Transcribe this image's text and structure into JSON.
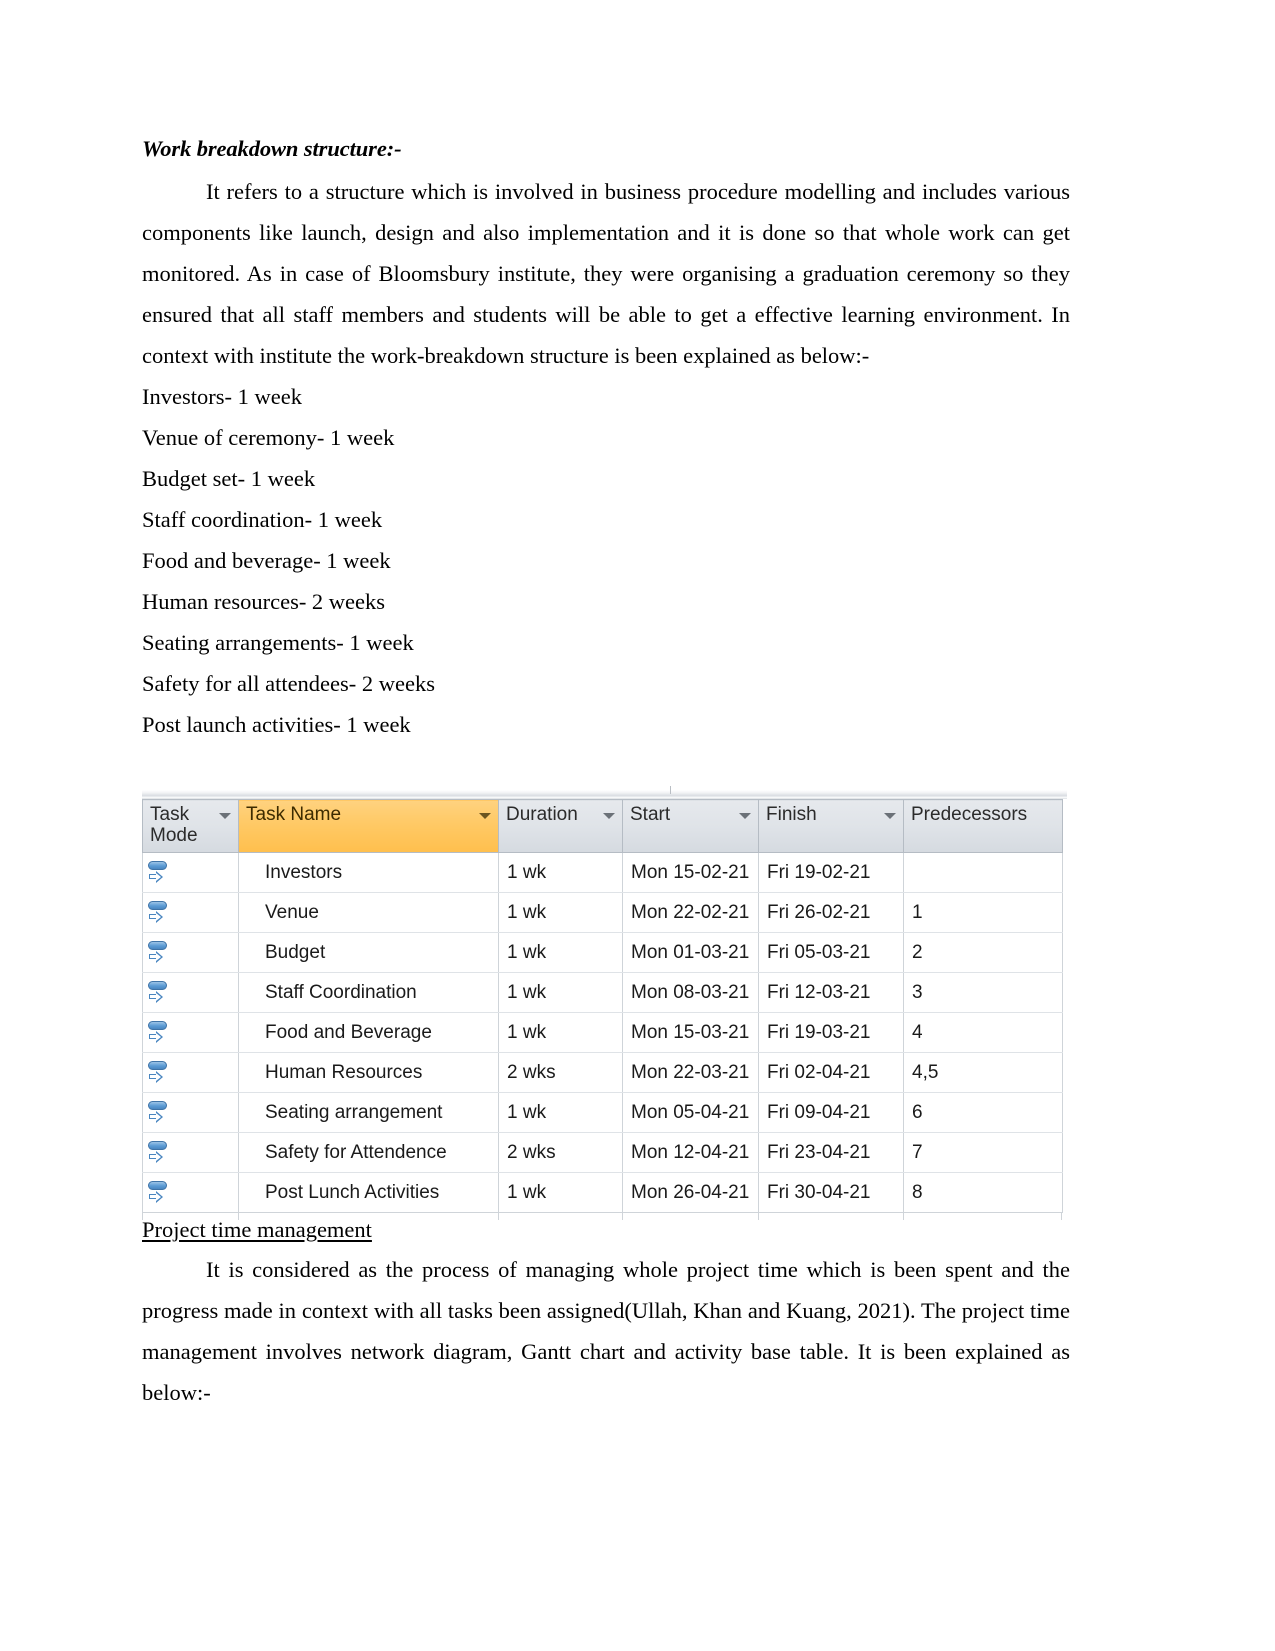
{
  "document": {
    "section1": {
      "heading": "Work breakdown structure:-",
      "paragraph": "It refers to a structure which is involved in business procedure modelling and includes various components like launch, design and also implementation and it is done so that whole work can get monitored. As in case of Bloomsbury institute, they were organising a graduation ceremony so they ensured that all staff members and students will be able to get a effective learning environment. In context with institute the work-breakdown structure is been explained as below:-",
      "wbs_items": [
        "Investors- 1 week",
        "Venue of ceremony- 1 week",
        "Budget set- 1 week",
        "Staff coordination- 1 week",
        "Food and beverage- 1 week",
        "Human resources- 2 weeks",
        "Seating arrangements- 1 week",
        "Safety for all attendees- 2 weeks",
        "Post launch activities- 1 week"
      ]
    },
    "project_table": {
      "columns": [
        {
          "label": "Task Mode",
          "selected": false
        },
        {
          "label": "Task Name",
          "selected": true
        },
        {
          "label": "Duration",
          "selected": false
        },
        {
          "label": "Start",
          "selected": false
        },
        {
          "label": "Finish",
          "selected": false
        },
        {
          "label": "Predecessors",
          "selected": false
        }
      ],
      "rows": [
        {
          "mode": "auto-scheduled-icon",
          "name": "Investors",
          "duration": "1 wk",
          "start": "Mon 15-02-21",
          "finish": "Fri 19-02-21",
          "predecessors": ""
        },
        {
          "mode": "auto-scheduled-icon",
          "name": "Venue",
          "duration": "1 wk",
          "start": "Mon 22-02-21",
          "finish": "Fri 26-02-21",
          "predecessors": "1"
        },
        {
          "mode": "auto-scheduled-icon",
          "name": "Budget",
          "duration": "1 wk",
          "start": "Mon 01-03-21",
          "finish": "Fri 05-03-21",
          "predecessors": "2"
        },
        {
          "mode": "auto-scheduled-icon",
          "name": "Staff Coordination",
          "duration": "1 wk",
          "start": "Mon 08-03-21",
          "finish": "Fri 12-03-21",
          "predecessors": "3"
        },
        {
          "mode": "auto-scheduled-icon",
          "name": "Food and Beverage",
          "duration": "1 wk",
          "start": "Mon 15-03-21",
          "finish": "Fri 19-03-21",
          "predecessors": "4"
        },
        {
          "mode": "auto-scheduled-icon",
          "name": "Human Resources",
          "duration": "2 wks",
          "start": "Mon 22-03-21",
          "finish": "Fri 02-04-21",
          "predecessors": "4,5"
        },
        {
          "mode": "auto-scheduled-icon",
          "name": "Seating arrangement",
          "duration": "1 wk",
          "start": "Mon 05-04-21",
          "finish": "Fri 09-04-21",
          "predecessors": "6"
        },
        {
          "mode": "auto-scheduled-icon",
          "name": "Safety for Attendence",
          "duration": "2 wks",
          "start": "Mon 12-04-21",
          "finish": "Fri 23-04-21",
          "predecessors": "7"
        },
        {
          "mode": "auto-scheduled-icon",
          "name": "Post Lunch Activities",
          "duration": "1 wk",
          "start": "Mon 26-04-21",
          "finish": "Fri 30-04-21",
          "predecessors": "8"
        }
      ]
    },
    "section2": {
      "heading": "Project time management",
      "paragraph": "It is considered as the process of managing whole project time which is been spent and the progress made in context with all tasks been assigned(Ullah, Khan and Kuang,  2021). The project time management involves network diagram, Gantt chart and activity base table. It is been explained as below:-"
    }
  },
  "colors": {
    "selected_header": "#ffc965",
    "header_grey": "#dfe3e8",
    "grid_line": "#cfd4d9",
    "task_mode_blue": "#5b9bd5",
    "text": "#000000"
  }
}
